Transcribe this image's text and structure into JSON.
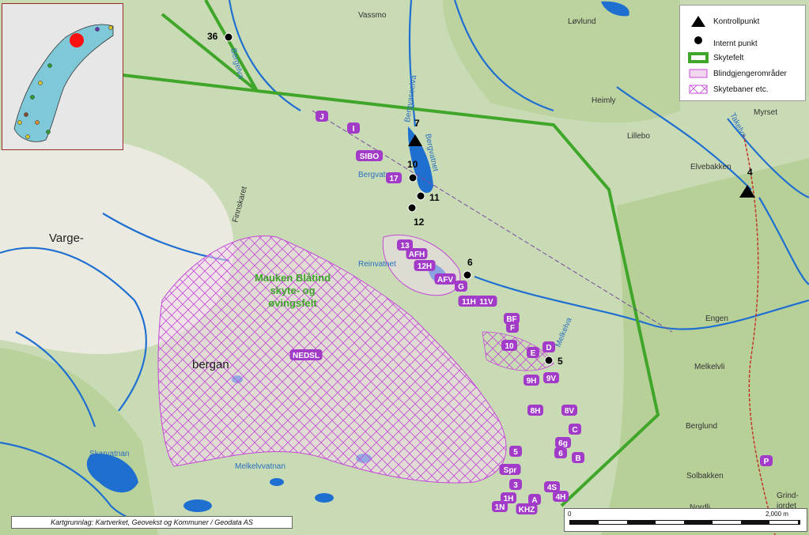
{
  "legend": {
    "items": [
      {
        "label": "Kontrollpunkt",
        "icon": "triangle-icon"
      },
      {
        "label": "Internt punkt",
        "icon": "dot-icon"
      },
      {
        "label": "Skytefelt",
        "icon": "green-boundary-icon"
      },
      {
        "label": "Blindgjengerområder",
        "icon": "pink-area-icon"
      },
      {
        "label": "Skytebaner etc.",
        "icon": "crosshatch-icon"
      }
    ]
  },
  "credit": "Kartgrunnlag: Kartverket, Geovekst og Kommuner / Geodata AS",
  "scale": {
    "start": "0",
    "end": "2,000 m"
  },
  "places": {
    "vassmo": "Vassmo",
    "lovlund": "Løvlund",
    "heimly": "Heimly",
    "myrset": "Myrset",
    "lillebo": "Lillebo",
    "elvebakken": "Elvebakken",
    "engen": "Engen",
    "melkelvli": "Melkelvli",
    "berglund": "Berglund",
    "solbakken": "Solbakken",
    "nordli": "Nordli",
    "grind1": "Grind-",
    "grind2": "jordet",
    "varge": "Varge-",
    "bergan": "bergan",
    "finnskaret": "Finnskaret"
  },
  "water": {
    "bergelva": "Bergelva",
    "bergvasselva": "Bergvasselva",
    "bergvatnet": "Bergvatnet",
    "bergvatnet_short": "Bergvatnet",
    "reinvatnet": "Reinvatnet",
    "melkelva": "Melkelva",
    "takelva": "Takelva",
    "skarvatnan": "Skarvatnan",
    "melkelvvatnan": "Melkelvvatnan"
  },
  "field_name": [
    "Mauken Blåtind",
    "skyte- og",
    "øvingsfelt"
  ],
  "control_points": [
    {
      "id": "7"
    },
    {
      "id": "4"
    }
  ],
  "internal_points": [
    {
      "id": "36"
    },
    {
      "id": "10"
    },
    {
      "id": "11"
    },
    {
      "id": "12"
    },
    {
      "id": "6"
    },
    {
      "id": "5"
    }
  ],
  "range_labels": [
    "J",
    "I",
    "SIBO",
    "17",
    "13",
    "AFH",
    "12H",
    "AFV",
    "G",
    "11H",
    "11V",
    "BF",
    "F",
    "10",
    "E",
    "D",
    "9H",
    "9V",
    "8H",
    "8V",
    "C",
    "6g",
    "6",
    "B",
    "5",
    "Spr",
    "3",
    "1H",
    "1N",
    "A",
    "KHZ",
    "4S",
    "4H",
    "NEDSL",
    "P"
  ],
  "colors": {
    "boundary": "#3fa62a",
    "range": "#a23bc8",
    "water": "#1f6fd1"
  }
}
